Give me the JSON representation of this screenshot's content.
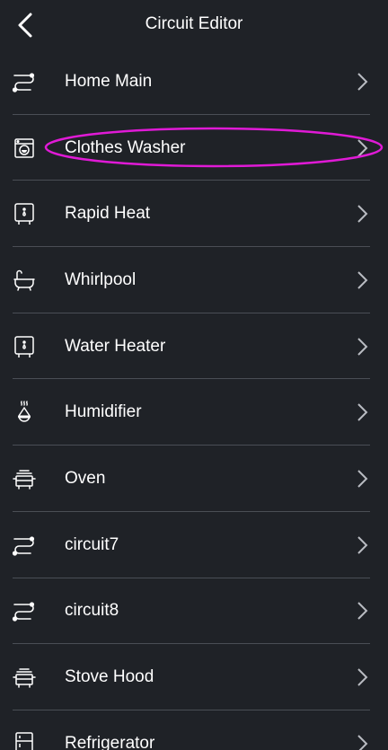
{
  "header": {
    "title": "Circuit Editor",
    "back_icon": "chevron-left-icon"
  },
  "circuits": [
    {
      "label": "Home Main",
      "icon": "circuit-icon"
    },
    {
      "label": "Clothes Washer",
      "icon": "washer-icon"
    },
    {
      "label": "Rapid Heat",
      "icon": "heater-icon"
    },
    {
      "label": "Whirlpool",
      "icon": "bathtub-icon"
    },
    {
      "label": "Water Heater",
      "icon": "heater-icon"
    },
    {
      "label": "Humidifier",
      "icon": "humidifier-icon"
    },
    {
      "label": "Oven",
      "icon": "pot-icon"
    },
    {
      "label": "circuit7",
      "icon": "circuit-icon"
    },
    {
      "label": "circuit8",
      "icon": "circuit-icon"
    },
    {
      "label": "Stove Hood",
      "icon": "pot-icon"
    },
    {
      "label": "Refrigerator",
      "icon": "fridge-icon"
    }
  ],
  "annotation": {
    "highlight_color": "#e01ad6"
  },
  "colors": {
    "background": "#1f2227",
    "divider": "#4a4e55",
    "text": "#ffffff",
    "chevron": "#b9bcc2"
  }
}
